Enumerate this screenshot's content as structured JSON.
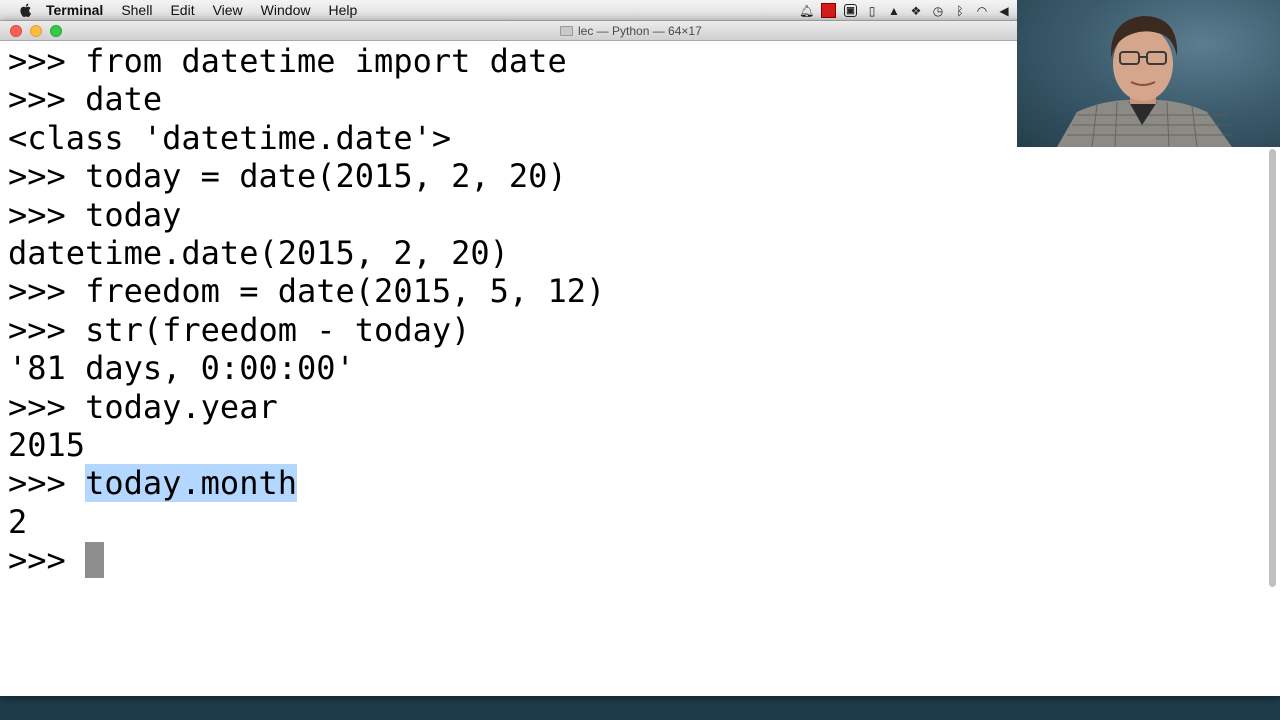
{
  "menubar": {
    "app_name": "Terminal",
    "items": [
      "Shell",
      "Edit",
      "View",
      "Window",
      "Help"
    ]
  },
  "window": {
    "title": "lec — Python — 64×17"
  },
  "terminal": {
    "lines": [
      {
        "prompt": ">>> ",
        "text": "from datetime import date"
      },
      {
        "prompt": ">>> ",
        "text": "date"
      },
      {
        "prompt": "",
        "text": "<class 'datetime.date'>"
      },
      {
        "prompt": ">>> ",
        "text": "today = date(2015, 2, 20)"
      },
      {
        "prompt": ">>> ",
        "text": "today"
      },
      {
        "prompt": "",
        "text": "datetime.date(2015, 2, 20)"
      },
      {
        "prompt": ">>> ",
        "text": "freedom = date(2015, 5, 12)"
      },
      {
        "prompt": ">>> ",
        "text": "str(freedom - today)"
      },
      {
        "prompt": "",
        "text": "'81 days, 0:00:00'"
      },
      {
        "prompt": ">>> ",
        "text": "today.year"
      },
      {
        "prompt": "",
        "text": "2015"
      },
      {
        "prompt": ">>> ",
        "text": "today.month",
        "selected": true
      },
      {
        "prompt": "",
        "text": "2"
      },
      {
        "prompt": ">>> ",
        "text": "",
        "cursor": true
      }
    ]
  },
  "colors": {
    "selection": "#b3d7ff",
    "cursor": "#8d8d8d",
    "close": "#fc605c",
    "minimize": "#fdbc40",
    "maximize": "#34c84a"
  },
  "icons": {
    "status": [
      "notification-bell-icon",
      "record-icon",
      "camera-icon",
      "battery-icon",
      "drive-icon",
      "dropbox-icon",
      "time-machine-icon",
      "bluetooth-icon",
      "wifi-icon",
      "volume-icon"
    ]
  }
}
